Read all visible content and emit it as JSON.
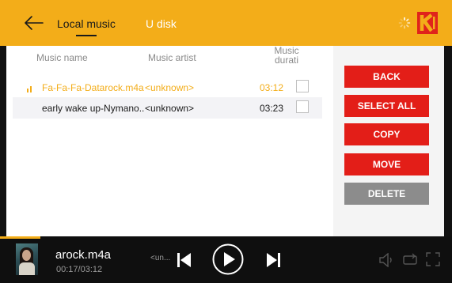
{
  "header": {
    "tabs": [
      {
        "label": "Local music",
        "active": true
      },
      {
        "label": "U disk",
        "active": false
      }
    ],
    "brand_color": "#e0231b",
    "accent_color": "#f3ad19"
  },
  "table": {
    "columns": [
      "Music name",
      "Music artist",
      "Music durati"
    ],
    "rows": [
      {
        "name": "Fa-Fa-Fa-Datarock.m4a",
        "artist": "<unknown>",
        "duration": "03:12",
        "playing": true,
        "checked": false
      },
      {
        "name": "early wake up-Nymano....",
        "artist": "<unknown>",
        "duration": "03:23",
        "playing": false,
        "checked": false
      }
    ]
  },
  "actions": {
    "back": "BACK",
    "select_all": "SELECT ALL",
    "copy": "COPY",
    "move": "MOVE",
    "delete": "DELETE"
  },
  "player": {
    "title": "arock.m4a",
    "artist": "<un...",
    "time": "00:17/03:12",
    "progress_fraction": 0.09
  }
}
